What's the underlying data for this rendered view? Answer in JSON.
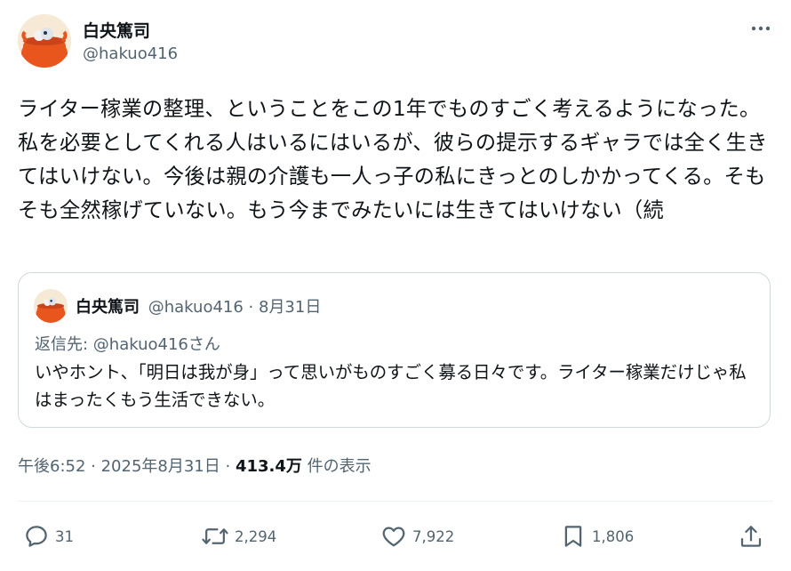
{
  "author": {
    "display_name": "白央篤司",
    "handle": "@hakuo416"
  },
  "tweet": {
    "text": "ライター稼業の整理、ということをこの1年でものすごく考えるようになった。私を必要としてくれる人はいるにはいるが、彼らの提示するギャラでは全く生きてはいけない。今後は親の介護も一人っ子の私にきっとのしかかってくる。そもそも全然稼げていない。もう今までみたいには生きてはいけない（続"
  },
  "quote": {
    "display_name": "白央篤司",
    "meta": "@hakuo416 · 8月31日",
    "reply_to": "返信先: @hakuo416さん",
    "text": "いやホント、「明日は我が身」って思いがものすごく募る日々です。ライター稼業だけじゃ私はまったくもう生活できない。"
  },
  "meta": {
    "timestamp": "午後6:52 · 2025年8月31日",
    "separator": " · ",
    "views_count": "413.4万",
    "views_label": " 件の表示"
  },
  "actions": {
    "replies": "31",
    "reposts": "2,294",
    "likes": "7,922",
    "bookmarks": "1,806"
  },
  "icons": {
    "more": "more-horizontal-icon",
    "reply": "reply-icon",
    "repost": "repost-icon",
    "like": "heart-icon",
    "bookmark": "bookmark-icon",
    "share": "share-icon"
  },
  "colors": {
    "text_primary": "#0f1419",
    "text_secondary": "#536471",
    "border": "#cfd9de",
    "avatar_accent": "#e8561e"
  }
}
